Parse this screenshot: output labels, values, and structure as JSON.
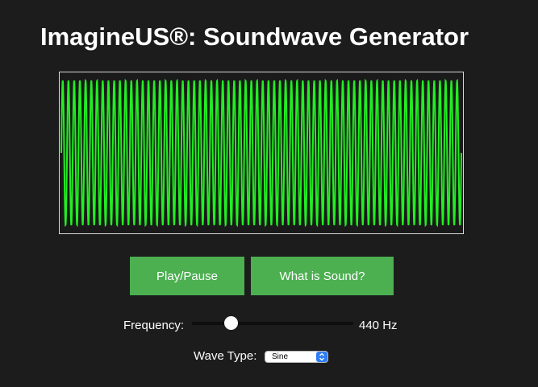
{
  "header": {
    "title": "ImagineUS®: Soundwave Generator"
  },
  "waveform": {
    "cycles": 70,
    "color": "#22ee22"
  },
  "controls": {
    "play_pause_label": "Play/Pause",
    "what_is_sound_label": "What is Sound?",
    "button_color": "#4caf50",
    "frequency_label": "Frequency:",
    "frequency_value": "440 Hz",
    "frequency_slider_level": 0.24,
    "wave_type_label": "Wave Type:",
    "wave_type_selected": "Sine"
  }
}
